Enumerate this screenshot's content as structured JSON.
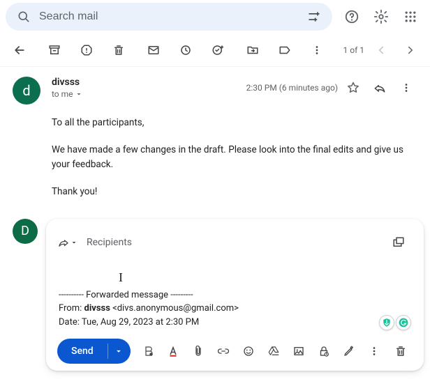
{
  "search": {
    "placeholder": "Search mail"
  },
  "toolbar": {
    "counter": "1 of 1"
  },
  "email": {
    "sender_avatar": "d",
    "sender_name": "divsss",
    "to_line": "to me",
    "timestamp": "2:30 PM (6 minutes ago)",
    "body": {
      "p1": "To all the participants,",
      "p2": "We have made a few changes in the draft. Please look into the final edits and give us your feedback.",
      "p3": "Thank you!"
    }
  },
  "compose": {
    "avatar": "D",
    "recipients_label": "Recipients",
    "fwd_divider": "---------- Forwarded message ---------",
    "from_label": "From: ",
    "from_name": "divsss",
    "from_email": " <divs.anonymous@gmail.com>",
    "date_line": "Date: Tue, Aug 29, 2023 at 2:30 PM",
    "send_label": "Send"
  }
}
